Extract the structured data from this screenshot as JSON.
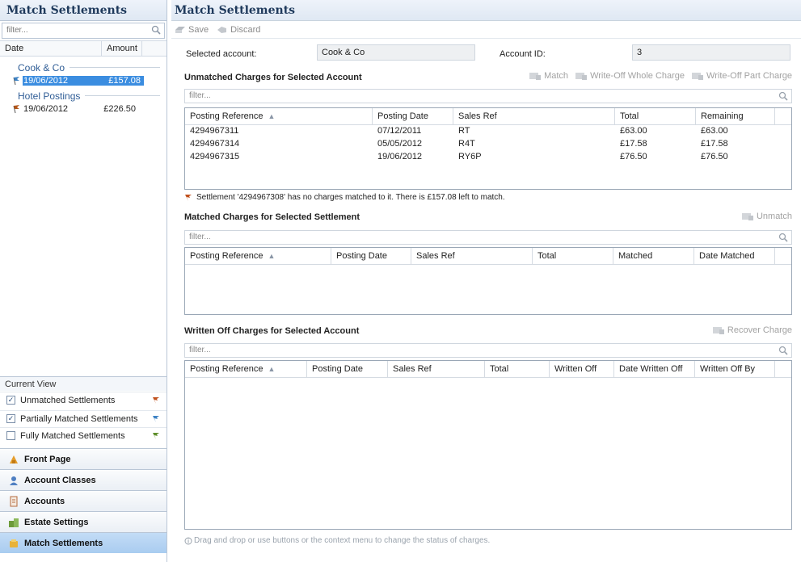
{
  "left": {
    "title": "Match Settlements",
    "filter_placeholder": "filter...",
    "columns": {
      "date": "Date",
      "amount": "Amount"
    },
    "groups": [
      {
        "name": "Cook & Co",
        "rows": [
          {
            "date": "19/06/2012",
            "amount": "£157.08",
            "flag_color": "#3d82c4"
          }
        ]
      },
      {
        "name": "Hotel Postings",
        "rows": [
          {
            "date": "19/06/2012",
            "amount": "£226.50",
            "flag_color": "#b4571a"
          }
        ]
      }
    ],
    "current_view": {
      "title": "Current View",
      "items": [
        {
          "label": "Unmatched Settlements",
          "checked": true,
          "flag_color": "#c0501c"
        },
        {
          "label": "Partially Matched Settlements",
          "checked": true,
          "flag_color": "#3d82c4"
        },
        {
          "label": "Fully Matched Settlements",
          "checked": false,
          "flag_color": "#5e8e2a"
        }
      ]
    },
    "nav": [
      {
        "label": "Front Page",
        "icon": "front-page-icon"
      },
      {
        "label": "Account Classes",
        "icon": "account-classes-icon"
      },
      {
        "label": "Accounts",
        "icon": "accounts-icon"
      },
      {
        "label": "Estate Settings",
        "icon": "estate-settings-icon"
      },
      {
        "label": "Match Settlements",
        "icon": "match-settlements-icon",
        "active": true
      }
    ]
  },
  "right": {
    "title": "Match Settlements",
    "toolbar": {
      "save": "Save",
      "discard": "Discard"
    },
    "selected_account_label": "Selected account:",
    "selected_account_value": "Cook & Co",
    "account_id_label": "Account ID:",
    "account_id_value": "3",
    "unmatched": {
      "title": "Unmatched Charges for Selected Account",
      "actions": {
        "match": "Match",
        "write_off_whole": "Write-Off Whole Charge",
        "write_off_part": "Write-Off Part Charge"
      },
      "filter_placeholder": "filter...",
      "columns": [
        "Posting Reference",
        "Posting Date",
        "Sales Ref",
        "Total",
        "Remaining"
      ],
      "rows": [
        [
          "4294967311",
          "07/12/2011",
          "RT",
          "£63.00",
          "£63.00"
        ],
        [
          "4294967314",
          "05/05/2012",
          "R4T",
          "£17.58",
          "£17.58"
        ],
        [
          "4294967315",
          "19/06/2012",
          "RY6P",
          "£76.50",
          "£76.50"
        ]
      ]
    },
    "note": "Settlement '4294967308' has no charges matched to it. There is £157.08 left to match.",
    "matched": {
      "title": "Matched Charges for Selected Settlement",
      "actions": {
        "unmatch": "Unmatch"
      },
      "filter_placeholder": "filter...",
      "columns": [
        "Posting Reference",
        "Posting Date",
        "Sales Ref",
        "Total",
        "Matched",
        "Date Matched"
      ]
    },
    "written_off": {
      "title": "Written Off Charges for Selected Account",
      "actions": {
        "recover": "Recover Charge"
      },
      "filter_placeholder": "filter...",
      "columns": [
        "Posting Reference",
        "Posting Date",
        "Sales Ref",
        "Total",
        "Written Off",
        "Date Written Off",
        "Written Off By"
      ]
    },
    "hint": "Drag and drop or use buttons or the context menu to change the status of charges."
  }
}
